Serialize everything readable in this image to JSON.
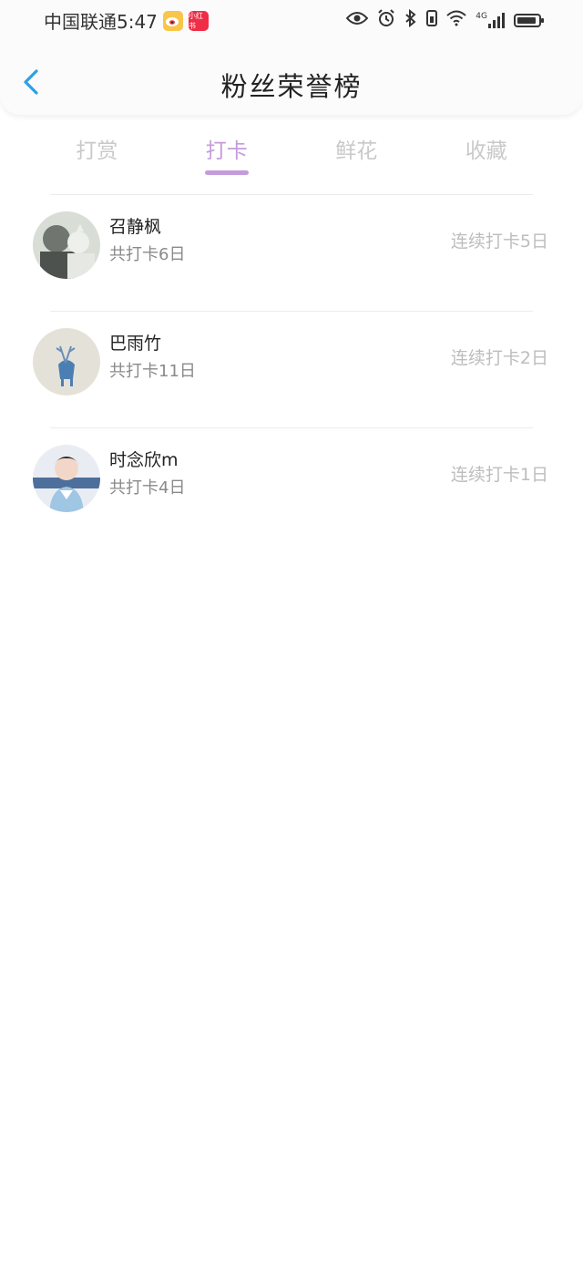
{
  "status_bar": {
    "carrier_time": "中国联通5:47",
    "weibo_icon": "weibo-icon",
    "xhs_label": "小红书",
    "network": "4G"
  },
  "nav": {
    "title": "粉丝荣誉榜",
    "back_icon": "chevron-left-icon"
  },
  "tabs": [
    {
      "label": "打赏",
      "active": false
    },
    {
      "label": "打卡",
      "active": true
    },
    {
      "label": "鲜花",
      "active": false
    },
    {
      "label": "收藏",
      "active": false
    }
  ],
  "colors": {
    "accent": "#c59bdc",
    "back_icon": "#2f9fe4",
    "streak_text": "#bdbdbd"
  },
  "list": [
    {
      "name": "召静枫",
      "total": "共打卡6日",
      "streak": "连续打卡5日"
    },
    {
      "name": "巴雨竹",
      "total": "共打卡11日",
      "streak": "连续打卡2日"
    },
    {
      "name": "时念欣m",
      "total": "共打卡4日",
      "streak": "连续打卡1日"
    }
  ]
}
